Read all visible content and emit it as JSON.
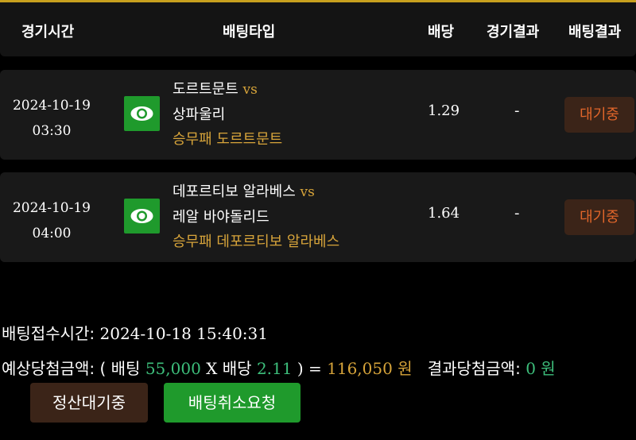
{
  "header": {
    "game_time": "경기시간",
    "bet_type": "배팅타입",
    "odds": "배당",
    "game_result": "경기결과",
    "bet_result": "배팅결과"
  },
  "rows": [
    {
      "date": "2024-10-19",
      "time": "03:30",
      "home": "도르트문트",
      "vs": "vs",
      "away": "상파울리",
      "pick": "승무패 도르트문트",
      "odds": "1.29",
      "result": "-",
      "status": "대기중",
      "icon": "eye-icon"
    },
    {
      "date": "2024-10-19",
      "time": "04:00",
      "home": "데포르티보 알라베스",
      "vs": "vs",
      "away": "레알 바야돌리드",
      "pick": "승무패 데포르티보 알라베스",
      "odds": "1.64",
      "result": "-",
      "status": "대기중",
      "icon": "eye-icon"
    }
  ],
  "summary": {
    "bet_time_label": "배팅접수시간:",
    "bet_time": "2024-10-18 15:40:31",
    "expected_label": "예상당첨금액: ( 배팅",
    "bet_amount": "55,000",
    "x": "X",
    "odds_label": "배당",
    "total_odds": "2.11",
    "close_eq": ") =",
    "expected_amount": "116,050",
    "won": "원",
    "result_label": "결과당첨금액:",
    "result_amount": "0",
    "result_won": "원"
  },
  "buttons": {
    "settle_pending": "정산대기중",
    "cancel_request": "배팅취소요청"
  },
  "colors": {
    "accent_gold": "#d7a43a",
    "green": "#1f9a2c",
    "status_orange": "#e2662a"
  }
}
